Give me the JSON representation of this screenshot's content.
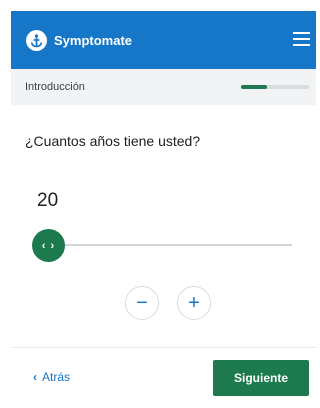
{
  "header": {
    "brand": "Symptomate",
    "logo_icon": "anchor-icon",
    "menu_icon": "hamburger-menu-icon",
    "color": "#1677c8"
  },
  "section": {
    "label": "Introducción",
    "progress": 0.38,
    "progress_color": "#1d7a4f"
  },
  "question": {
    "text": "¿Cuantos años tiene usted?",
    "value": "20"
  },
  "slider": {
    "thumb_label": "‹ ›",
    "accent": "#1d7a4f"
  },
  "controls": {
    "decrement": "−",
    "increment": "+"
  },
  "footer": {
    "back_icon": "‹",
    "back_label": "Atrás",
    "next_label": "Siguiente"
  }
}
